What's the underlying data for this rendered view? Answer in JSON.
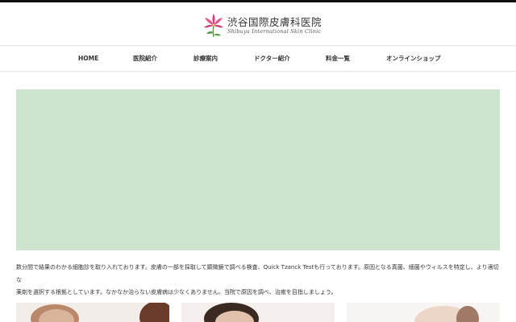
{
  "header": {
    "title_jp": "渋谷国際皮膚科医院",
    "title_en": "Shibuya International Skin Clinic",
    "logo_icon": "lily-flower-icon",
    "logo_color": "#d43c7a"
  },
  "nav": {
    "items": [
      {
        "label": "HOME"
      },
      {
        "label": "医院紹介"
      },
      {
        "label": "診療案内"
      },
      {
        "label": "ドクター紹介"
      },
      {
        "label": "料金一覧"
      },
      {
        "label": "オンラインショップ"
      }
    ]
  },
  "hero": {
    "color": "#cde4cf"
  },
  "intro": {
    "line1": "数分間で結果のわかる細胞診を取り入れております。皮膚の一部を採取して顕微鏡で調べる検査、Quick Tzanck Testも行っております。原因となる真菌、細菌やウィルスを特定し、より適切な",
    "line2": "薬剤を選択する根拠としています。なかなか治らない皮膚病は少なくありません。当院で原因を調べ、治癒を目指しましょう。"
  }
}
